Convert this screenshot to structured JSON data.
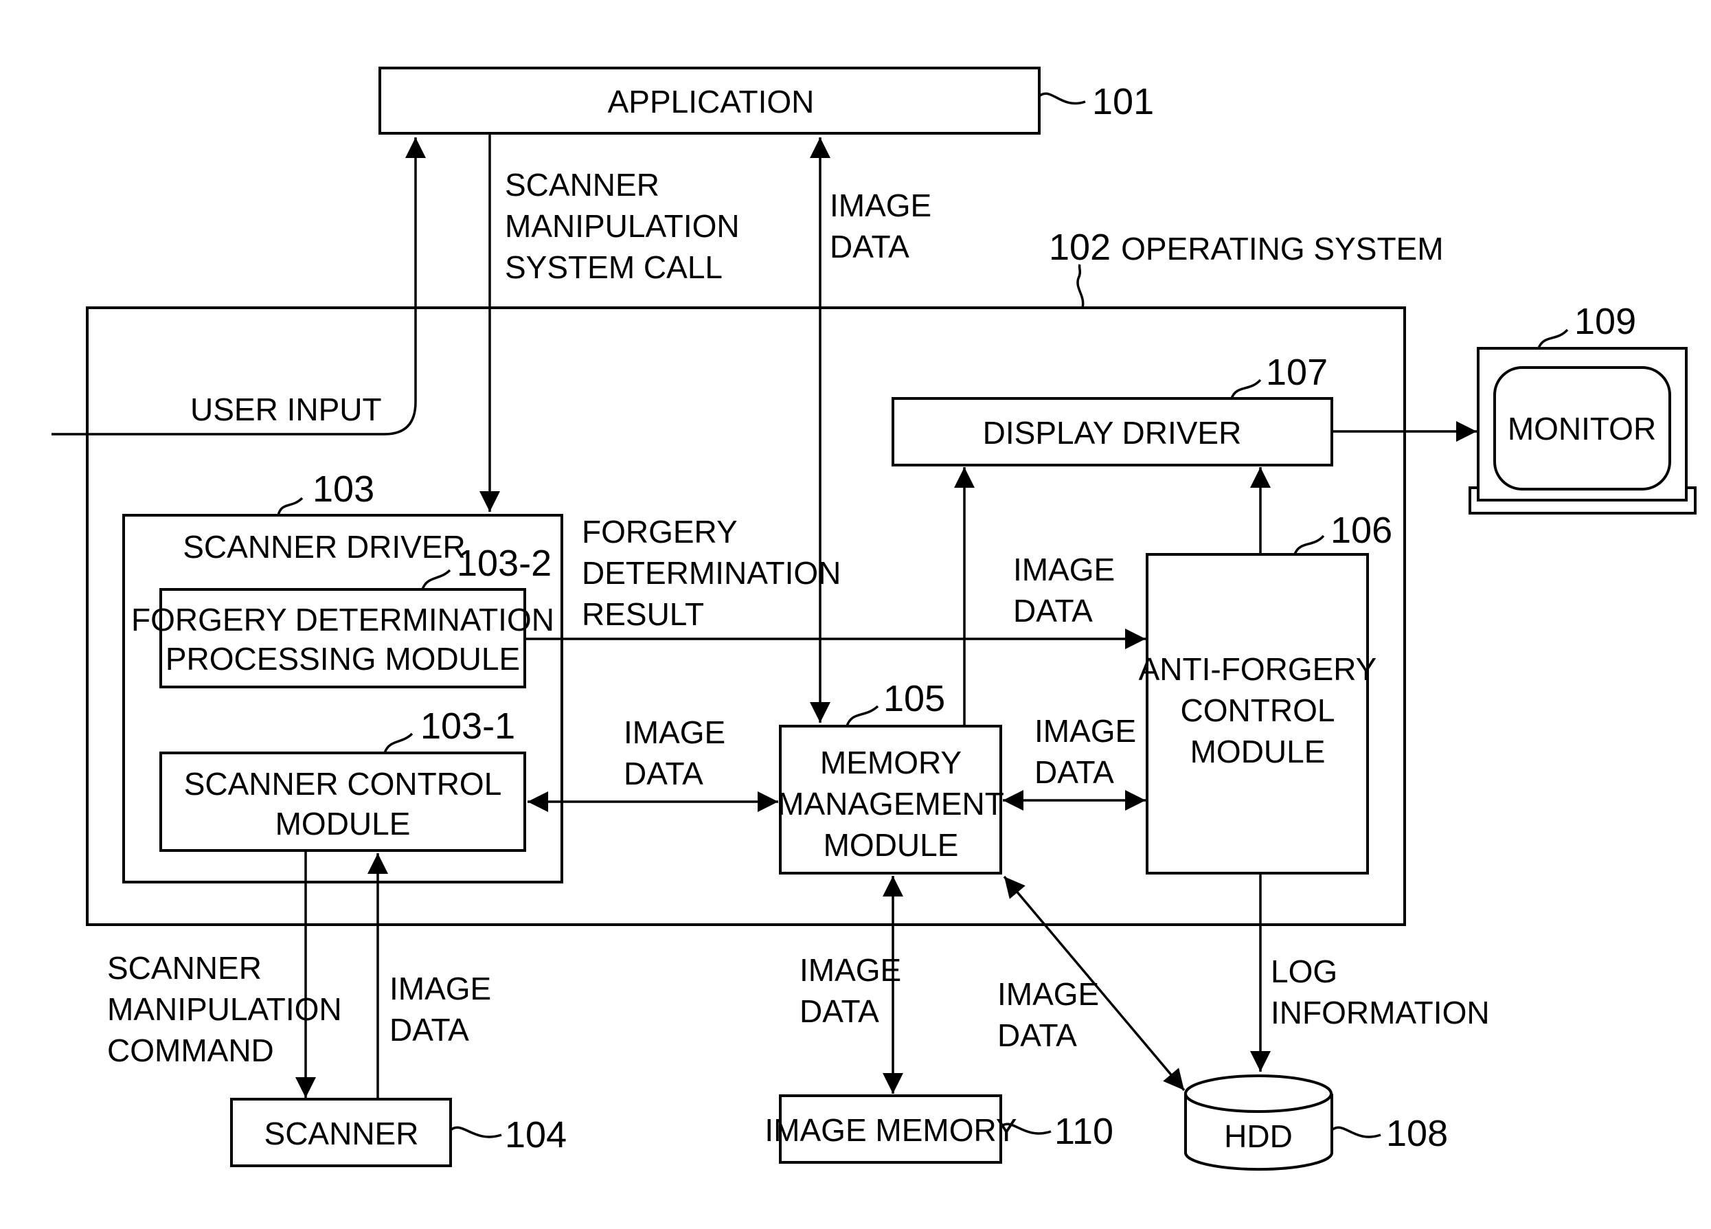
{
  "diagram": {
    "nodes": {
      "application": {
        "label": "APPLICATION",
        "ref": "101"
      },
      "operating_system": {
        "label": "OPERATING SYSTEM",
        "ref": "102"
      },
      "scanner_driver": {
        "label": "SCANNER DRIVER",
        "ref": "103"
      },
      "forgery_module": {
        "lines": [
          "FORGERY DETERMINATION",
          "PROCESSING MODULE"
        ],
        "ref": "103-2"
      },
      "scanner_control": {
        "lines": [
          "SCANNER CONTROL",
          "MODULE"
        ],
        "ref": "103-1"
      },
      "scanner": {
        "label": "SCANNER",
        "ref": "104"
      },
      "memory_management": {
        "lines": [
          "MEMORY",
          "MANAGEMENT",
          "MODULE"
        ],
        "ref": "105"
      },
      "anti_forgery": {
        "lines": [
          "ANTI-FORGERY",
          "CONTROL",
          "MODULE"
        ],
        "ref": "106"
      },
      "display_driver": {
        "label": "DISPLAY DRIVER",
        "ref": "107"
      },
      "hdd": {
        "label": "HDD",
        "ref": "108"
      },
      "monitor": {
        "label": "MONITOR",
        "ref": "109"
      },
      "image_memory": {
        "label": "IMAGE MEMORY",
        "ref": "110"
      }
    },
    "edge_labels": {
      "user_input": "USER INPUT",
      "syscall": [
        "SCANNER",
        "MANIPULATION",
        "SYSTEM CALL"
      ],
      "app_image_data": [
        "IMAGE",
        "DATA"
      ],
      "forgery_result": [
        "FORGERY",
        "DETERMINATION",
        "RESULT"
      ],
      "fd_to_af_image_data": [
        "IMAGE",
        "DATA"
      ],
      "sc_mm_image_data": [
        "IMAGE",
        "DATA"
      ],
      "mm_af_image_data": [
        "IMAGE",
        "DATA"
      ],
      "scanner_command": [
        "SCANNER",
        "MANIPULATION",
        "COMMAND"
      ],
      "scanner_image_data": [
        "IMAGE",
        "DATA"
      ],
      "mm_im_image_data": [
        "IMAGE",
        "DATA"
      ],
      "mm_hdd_image_data": [
        "IMAGE",
        "DATA"
      ],
      "log_information": [
        "LOG",
        "INFORMATION"
      ]
    }
  }
}
